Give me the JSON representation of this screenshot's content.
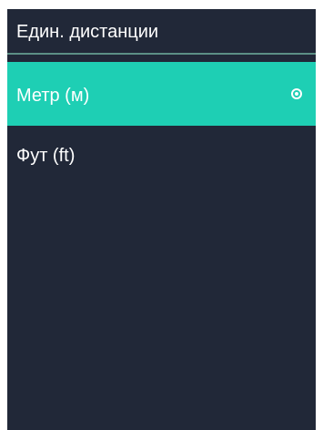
{
  "screen": {
    "title": "Един. дистанции",
    "background_color": "#212838",
    "accent_color": "#1ecfb4"
  },
  "options": [
    {
      "label": "Метр (м)",
      "selected": true,
      "indicator_icon": "radio-selected-icon"
    },
    {
      "label": "Фут (ft)",
      "selected": false
    }
  ]
}
